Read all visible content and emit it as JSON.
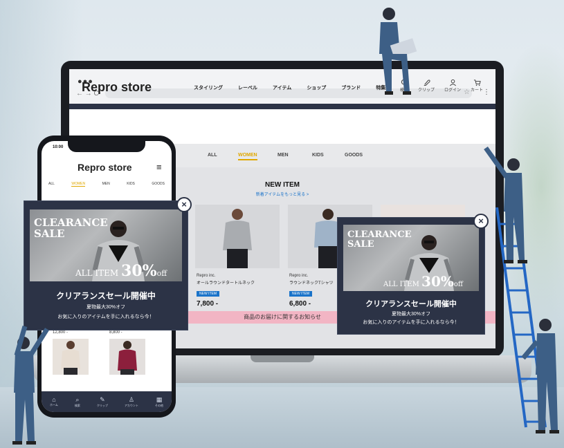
{
  "laptop": {
    "window_dots": "●●●",
    "nav_arrows": "← → C",
    "star": "☆",
    "kebab": "⋮",
    "site": {
      "logo": "Repro store",
      "nav": [
        "スタイリング",
        "レーベル",
        "アイテム",
        "ショップ",
        "ブランド",
        "特集"
      ],
      "icons": [
        {
          "icon": "search-icon",
          "label": "検索"
        },
        {
          "icon": "clip-icon",
          "label": "クリップ"
        },
        {
          "icon": "user-icon",
          "label": "ログイン"
        },
        {
          "icon": "cart-icon",
          "label": "カート"
        }
      ],
      "categories": [
        "ALL",
        "WOMEN",
        "MEN",
        "KIDS",
        "GOODS"
      ],
      "active_category": "WOMEN",
      "new_item": {
        "title": "NEW ITEM",
        "link": "新着アイテムをもっと見る >"
      },
      "products": [
        {
          "brand": "Repro inc.",
          "name": "オールラウンドタートルネック",
          "badge": "NEW ITEM",
          "price": "7,800 -"
        },
        {
          "brand": "Repro inc.",
          "name": "ラウンドネックTシャツ",
          "badge": "NEW ITEM",
          "price": "6,800 -"
        }
      ],
      "banner": "商品のお届けに関するお知らせ"
    },
    "popup": {
      "headline": "CLEARANCE SALE",
      "all_item": "ALL ITEM",
      "percent": "30%",
      "off": "off",
      "title": "クリアランスセール開催中",
      "line1": "夏物最大30%オフ",
      "line2": "お気に入りのアイテムを手に入れるなら今！",
      "close": "×"
    }
  },
  "phone": {
    "time": "10:00",
    "logo": "Repro store",
    "menu": "≡",
    "tabs": [
      "ALL",
      "WOMEN",
      "MEN",
      "KIDS",
      "GOODS"
    ],
    "active_tab": "WOMEN",
    "prices": [
      "12,800 -",
      "8,800 -"
    ],
    "footer": [
      {
        "icon": "home-icon",
        "label": "ホーム"
      },
      {
        "icon": "search-icon",
        "label": "検索"
      },
      {
        "icon": "clip-icon",
        "label": "クリップ"
      },
      {
        "icon": "user-icon",
        "label": "アカウント"
      },
      {
        "icon": "grid-icon",
        "label": "その他"
      }
    ],
    "popup": {
      "headline": "CLEARANCE SALE",
      "all_item": "ALL ITEM",
      "percent": "30%",
      "off": "off",
      "title": "クリアランスセール開催中",
      "line1": "夏物最大30%オフ",
      "line2": "お気に入りのアイテムを手に入れるなら今！",
      "close": "×"
    }
  },
  "colors": {
    "navy": "#2c3346",
    "accent_yellow": "#e0a800",
    "link_blue": "#1a73c9",
    "banner_pink": "#f2b5c4"
  }
}
